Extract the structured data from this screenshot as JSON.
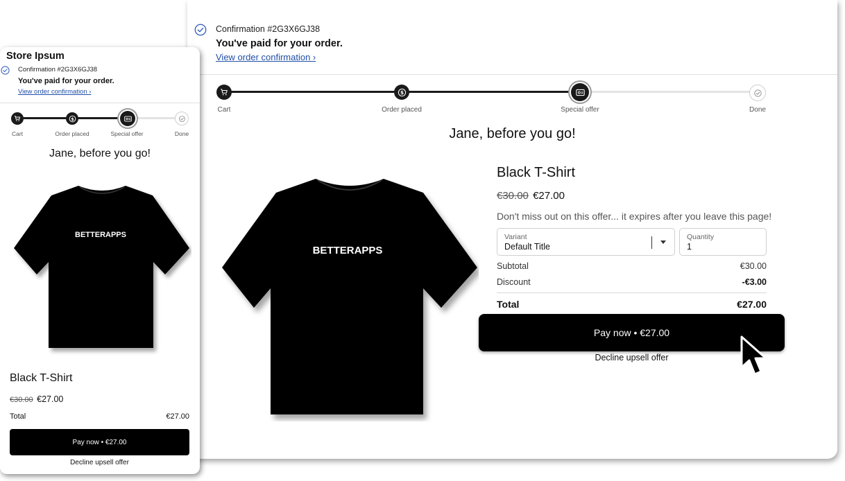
{
  "desktop": {
    "confirmation": "Confirmation #2G3X6GJ38",
    "paid_message": "You've paid for your order.",
    "view_confirmation": "View order confirmation ›",
    "steps": [
      "Cart",
      "Order placed",
      "Special offer",
      "Done"
    ],
    "heading": "Jane, before you go!",
    "product_title": "Black T-Shirt",
    "old_price": "€30.00",
    "price": "€27.00",
    "offer_text": "Don't miss out on this offer... it expires after you leave this page!",
    "variant_label": "Variant",
    "variant_value": "Default Title",
    "quantity_label": "Quantity",
    "quantity_value": "1",
    "subtotal_label": "Subtotal",
    "subtotal_value": "€30.00",
    "discount_label": "Discount",
    "discount_value": "-€3.00",
    "total_label": "Total",
    "total_value": "€27.00",
    "pay_button": "Pay now • €27.00",
    "decline": "Decline upsell offer",
    "shirt_print": "BETTERAPPS"
  },
  "mobile": {
    "store_name": "Store Ipsum",
    "confirmation": "Confirmation #2G3X6GJ38",
    "paid_message": "You've paid for your order.",
    "view_confirmation": "View order confirmation ›",
    "steps": [
      "Cart",
      "Order placed",
      "Special offer",
      "Done"
    ],
    "heading": "Jane, before you go!",
    "product_title": "Black T-Shirt",
    "old_price": "€30.00",
    "price": "€27.00",
    "total_label": "Total",
    "total_value": "€27.00",
    "pay_button": "Pay now • €27.00",
    "decline": "Decline upsell offer",
    "shirt_print": "BETTERAPPS"
  },
  "colors": {
    "primary": "#000000",
    "link": "#1f4ea8",
    "check": "#2b56b8",
    "progress_complete": "#1a1a1a",
    "progress_pending": "#e3e3e3"
  },
  "icons": [
    "check-circle-icon",
    "cart-icon",
    "dollar-circle-icon",
    "gift-card-icon",
    "done-check-icon",
    "chevron-down-icon",
    "mouse-pointer-icon"
  ]
}
